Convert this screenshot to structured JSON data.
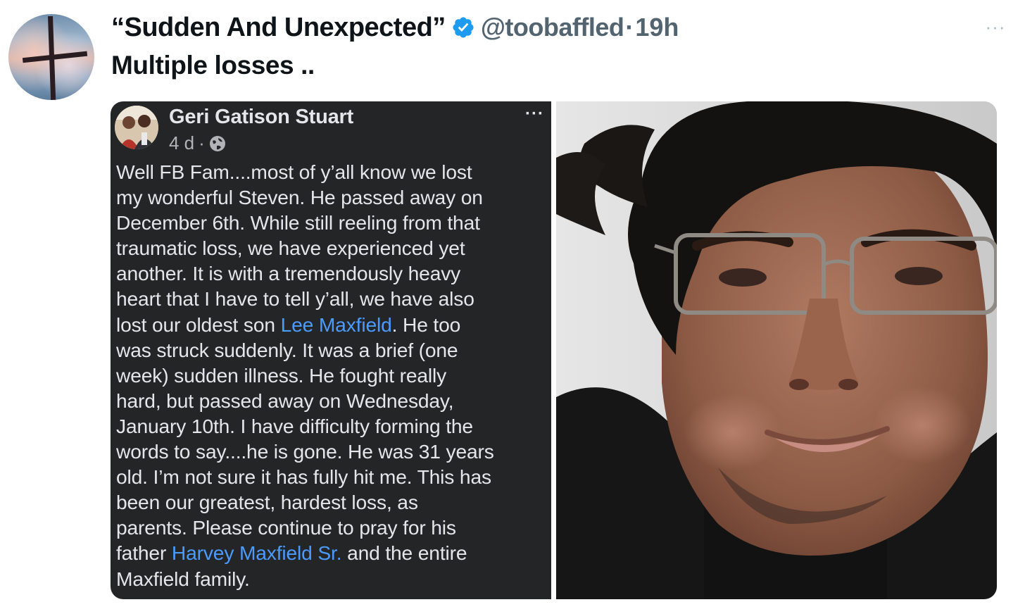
{
  "tweet": {
    "display_name": "“Sudden And Unexpected”",
    "handle": "@toobaffled",
    "separator": "·",
    "time": "19h",
    "more_label": "···",
    "text": "Multiple losses .."
  },
  "fb_post": {
    "author": "Geri Gatison Stuart",
    "age": "4 d",
    "meta_separator": "·",
    "more_label": "···",
    "lines": [
      {
        "parts": [
          {
            "text": "Well FB Fam....most of y’all know we lost"
          }
        ]
      },
      {
        "parts": [
          {
            "text": "my wonderful Steven. He passed away on"
          }
        ]
      },
      {
        "parts": [
          {
            "text": "December 6th. While still reeling from that"
          }
        ]
      },
      {
        "parts": [
          {
            "text": "traumatic loss, we have experienced yet"
          }
        ]
      },
      {
        "parts": [
          {
            "text": "another. It is with a tremendously heavy"
          }
        ]
      },
      {
        "parts": [
          {
            "text": "heart that I have to tell y’all, we have also"
          }
        ]
      },
      {
        "parts": [
          {
            "text": "lost our oldest son "
          },
          {
            "text": "Lee Maxfield",
            "link": true
          },
          {
            "text": ". He too"
          }
        ]
      },
      {
        "parts": [
          {
            "text": "was struck suddenly. It was a brief (one"
          }
        ]
      },
      {
        "parts": [
          {
            "text": "week) sudden illness. He fought really"
          }
        ]
      },
      {
        "parts": [
          {
            "text": "hard, but passed away on Wednesday,"
          }
        ]
      },
      {
        "parts": [
          {
            "text": "January 10th. I have difficulty forming the"
          }
        ]
      },
      {
        "parts": [
          {
            "text": "words to say....he is gone. He was 31 years"
          }
        ]
      },
      {
        "parts": [
          {
            "text": "old. I’m not sure it has fully hit me. This has"
          }
        ]
      },
      {
        "parts": [
          {
            "text": "been our greatest, hardest loss, as"
          }
        ]
      },
      {
        "parts": [
          {
            "text": "parents. Please continue to pray for his"
          }
        ]
      },
      {
        "parts": [
          {
            "text": "father "
          },
          {
            "text": "Harvey Maxfield Sr.",
            "link": true
          },
          {
            "text": " and the entire"
          }
        ]
      },
      {
        "parts": [
          {
            "text": "Maxfield family."
          }
        ]
      }
    ]
  },
  "icons": {
    "avatar": "cross-icon",
    "verified": "verified-badge-icon",
    "globe": "globe-icon",
    "more": "more-icon"
  },
  "colors": {
    "verified_blue": "#1d9bf0",
    "handle_gray": "#536471",
    "fb_background": "#242526",
    "fb_link": "#4b9bff"
  }
}
